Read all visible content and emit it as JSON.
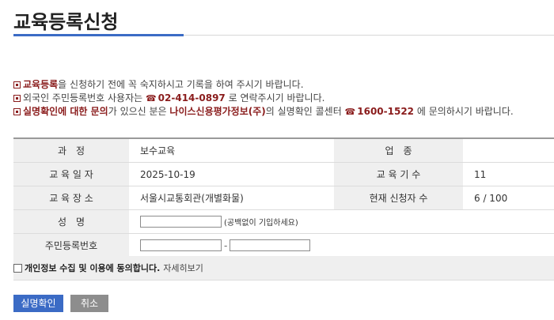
{
  "header": {
    "title": "교육등록신청"
  },
  "notices": {
    "line1": {
      "highlight": "교육등록",
      "text": "을 신청하기 전에 꼭 숙지하시고 기록을 하여 주시기 바랍니다."
    },
    "line2": {
      "prefix": "외국인 주민등록번호 사용자는 ",
      "phone_icon": "phone-icon",
      "phone": "02-414-0897",
      "suffix": " 로 연락주시기 바랍니다."
    },
    "line3": {
      "highlight1": "실명확인에 대한 문의",
      "text1": "가 있으신 분은 ",
      "highlight2": "나이스신용평가정보(주)",
      "text2": "의 실명확인 콜센터 ",
      "phone_icon": "phone-icon",
      "phone": "1600-1522",
      "suffix": " 에 문의하시기 바랍니다."
    }
  },
  "form": {
    "course_label": "과　정",
    "course_value": "보수교육",
    "industry_label": "업　종",
    "industry_value": "",
    "date_label": "교 육 일 자",
    "date_value": "2025-10-19",
    "term_label": "교 육 기 수",
    "term_value": "11",
    "place_label": "교 육 장 소",
    "place_value": "서울시교통회관(개별화물)",
    "applicants_label": "현재 신청자 수",
    "applicants_value": "6 / 100",
    "name_label": "성　명",
    "name_value": "",
    "name_hint": "(공백없이 기입하세요)",
    "rrn_label": "주민등록번호",
    "rrn_front": "",
    "rrn_dash": "-",
    "rrn_back": ""
  },
  "consent": {
    "label": "개인정보 수집 및 이용에 동의합니다.",
    "link": "자세히보기",
    "checked": false
  },
  "buttons": {
    "confirm": "실명확인",
    "cancel": "취소"
  },
  "colors": {
    "accent": "#3b6bc5",
    "highlight": "#8a1c1c",
    "cancel": "#8d8d8d"
  }
}
